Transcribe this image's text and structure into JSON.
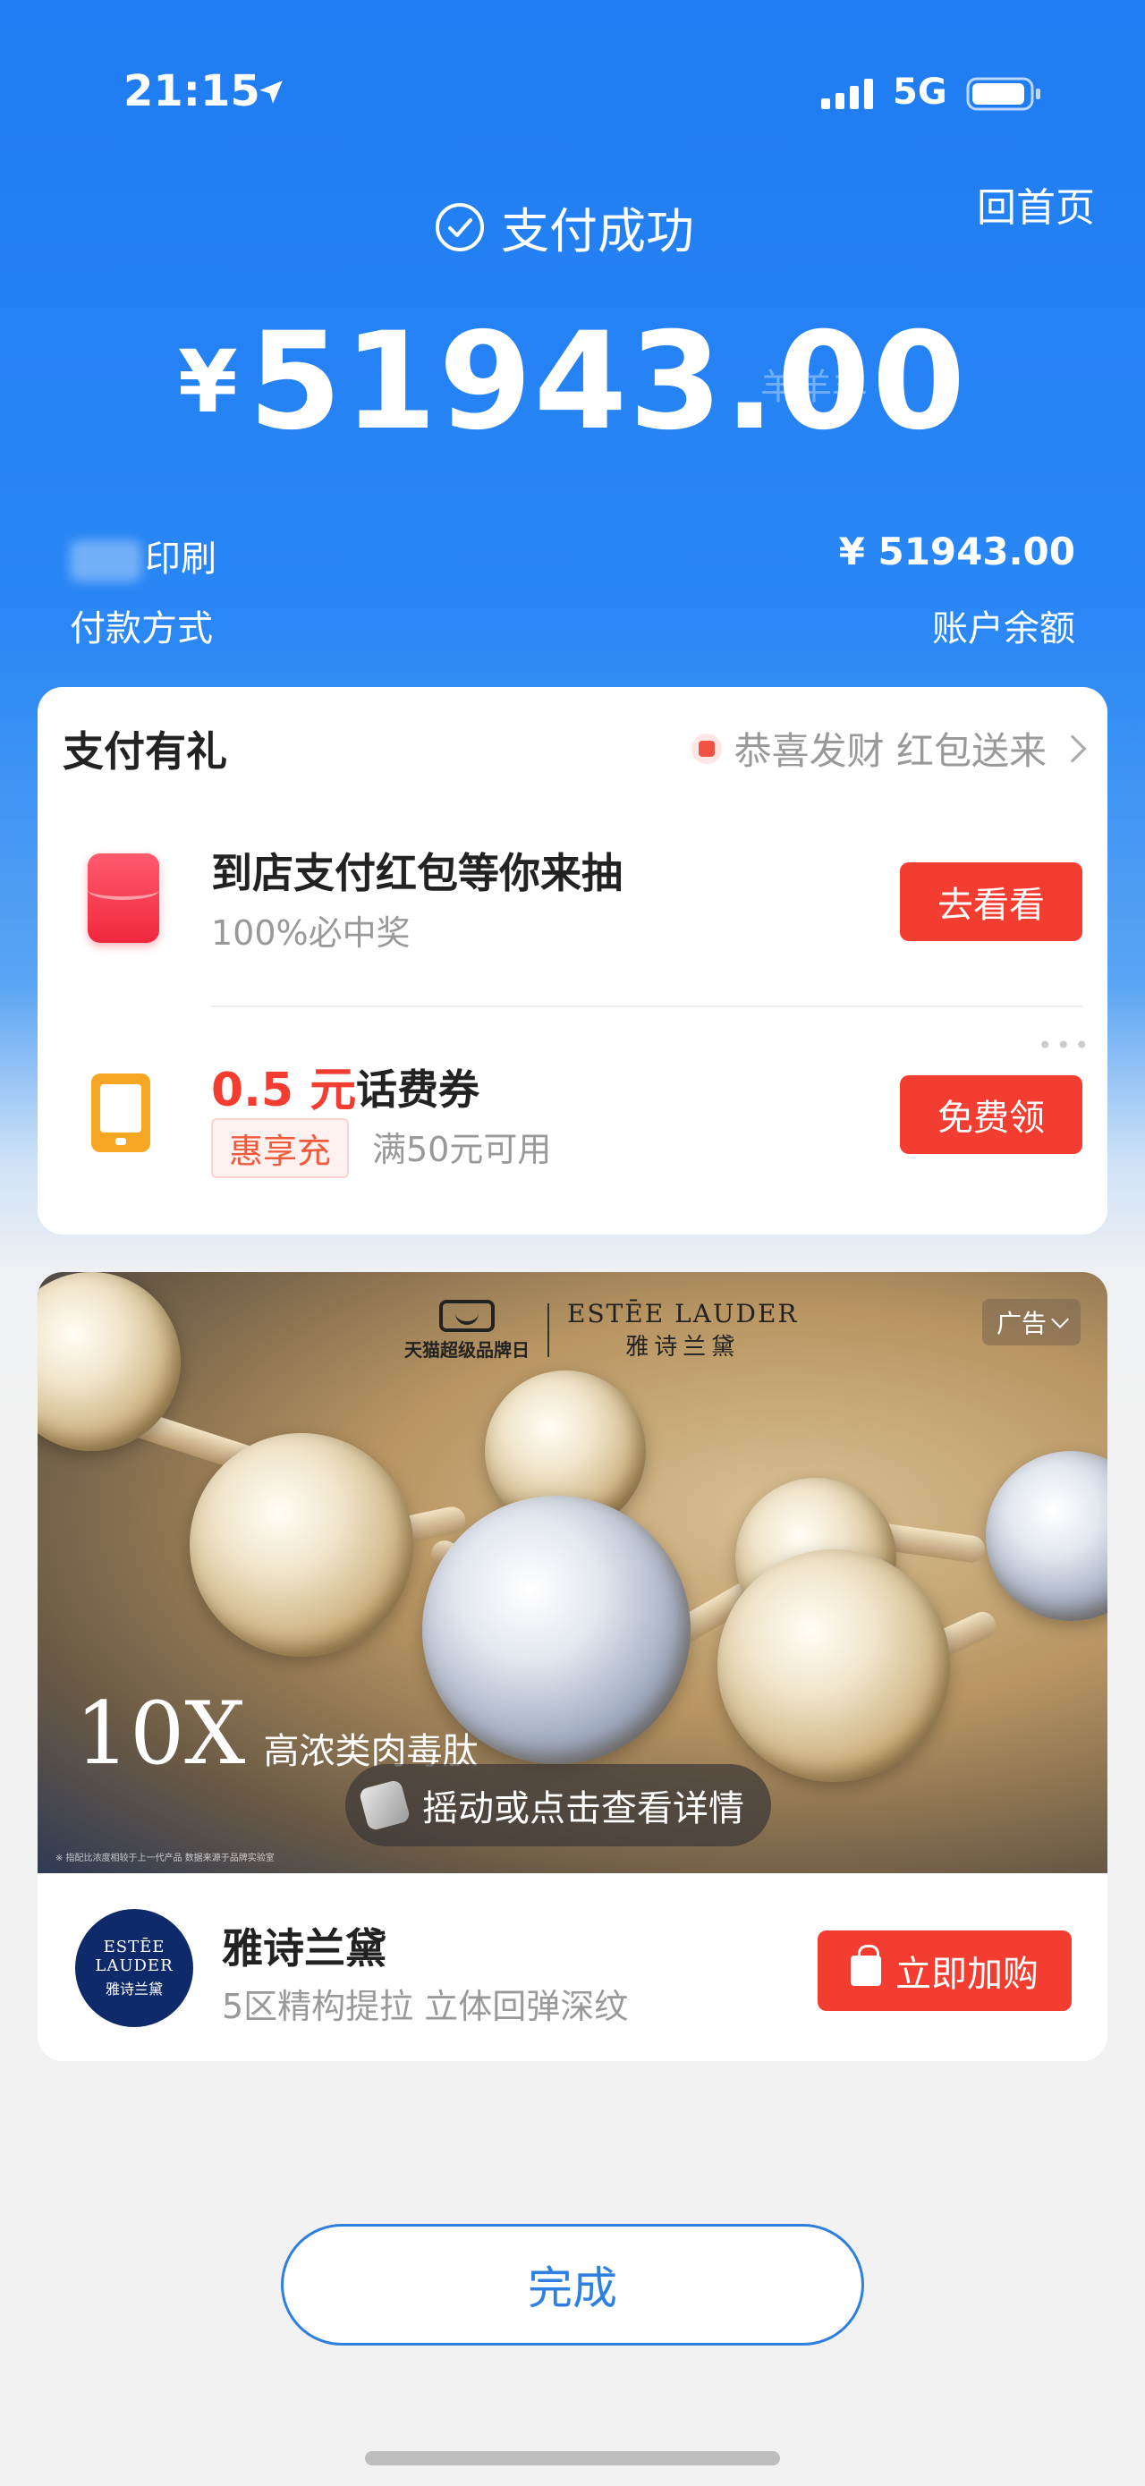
{
  "status_bar": {
    "time": "21:15",
    "network": "5G",
    "icons": [
      "location-arrow-icon",
      "signal-icon",
      "battery-icon"
    ]
  },
  "header": {
    "home_link": "回首页",
    "status_text": "支付成功",
    "currency_symbol": "¥",
    "amount": "51943.00",
    "watermark": "羊羊羊"
  },
  "payment_info": {
    "merchant_name": "印刷",
    "amount": "¥ 51943.00",
    "payment_method_label": "付款方式",
    "payment_method_value": "账户余额"
  },
  "gift_section": {
    "title": "支付有礼",
    "promo_text": "恭喜发财 红包送来",
    "items": [
      {
        "title": "到店支付红包等你来抽",
        "subtitle": "100%必中奖",
        "button": "去看看",
        "icon": "red-packet-icon"
      },
      {
        "amount": "0.5 元",
        "name": "话费券",
        "tag": "惠享充",
        "condition": "满50元可用",
        "button": "免费领",
        "icon": "phone-icon"
      }
    ],
    "more": "•••"
  },
  "ad": {
    "tag": "广告",
    "tmall_label": "天猫超级品牌日",
    "brand_en": "ESTĒE LAUDER",
    "brand_cn": "雅诗兰黛",
    "headline_big": "10X",
    "headline_small": "高浓类肉毒肽",
    "shake_text": "摇动或点击查看详情",
    "fine_print": "※ 指配比浓度相较于上一代产品 数据来源于品牌实验室",
    "brand_name": "雅诗兰黛",
    "slogan": "5区精构提拉 立体回弹深纹",
    "logo_line1": "ESTĒE",
    "logo_line2": "LAUDER",
    "logo_line3": "雅诗兰黛",
    "buy_button": "立即加购"
  },
  "footer": {
    "done_button": "完成"
  },
  "colors": {
    "primary_blue": "#1f7cf2",
    "accent_red": "#f23d30",
    "done_blue": "#2d7fe0"
  }
}
